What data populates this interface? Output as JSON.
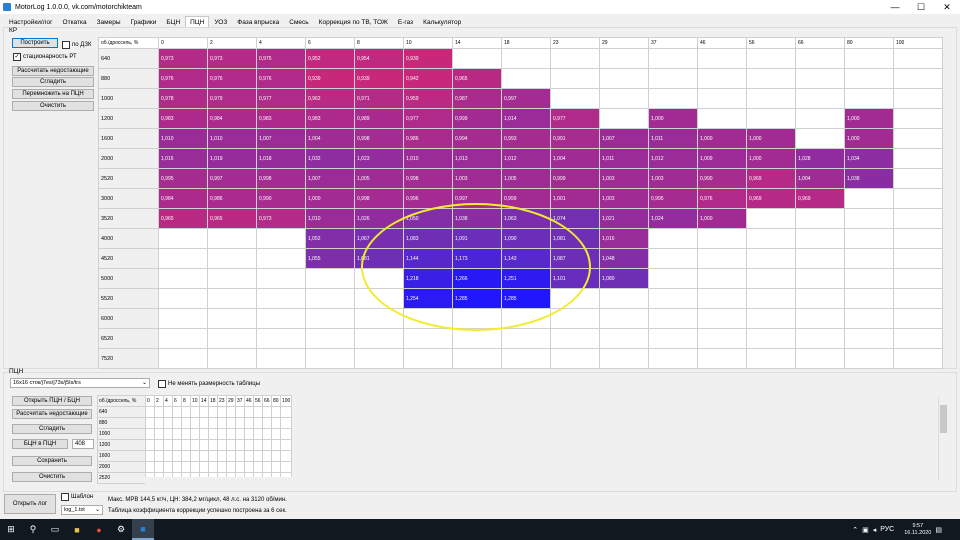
{
  "window": {
    "title": "MotorLog 1.0.0.0, vk.com/motorchikteam",
    "minimize": "—",
    "maximize": "☐",
    "close": "✕"
  },
  "tabs": [
    {
      "label": "Настройки/лог"
    },
    {
      "label": "Откатка"
    },
    {
      "label": "Замеры"
    },
    {
      "label": "Графики"
    },
    {
      "label": "БЦН"
    },
    {
      "label": "ПЦН",
      "active": true
    },
    {
      "label": "УОЗ"
    },
    {
      "label": "Фаза впрыска"
    },
    {
      "label": "Смесь"
    },
    {
      "label": "Коррекция по ТВ, ТОЖ"
    },
    {
      "label": "E-газ"
    },
    {
      "label": "Калькулятор"
    }
  ],
  "kp": {
    "group_label": "КР",
    "build_button": "Построить",
    "by_dzk_checkbox": "по ДЗК",
    "stationary_checkbox": "стационарность РТ",
    "calc_missing_button": "Рассчитать недостающие",
    "smooth_button": "Сгладить",
    "multiply_button": "Перемножить на ПЦН",
    "clear_button": "Очистить"
  },
  "kp_table": {
    "corner": "об./дроссель, %",
    "columns": [
      "0",
      "2",
      "4",
      "6",
      "8",
      "10",
      "14",
      "18",
      "23",
      "29",
      "37",
      "46",
      "56",
      "66",
      "80",
      "100"
    ],
    "rows": [
      {
        "rpm": "640",
        "cells": [
          "0,973",
          "0,973",
          "0,975",
          "0,952",
          "0,954",
          "0,939",
          "",
          "",
          "",
          "",
          "",
          "",
          "",
          "",
          "",
          ""
        ]
      },
      {
        "rpm": "880",
        "cells": [
          "0,976",
          "0,976",
          "0,976",
          "0,939",
          "0,939",
          "0,942",
          "0,965",
          "",
          "",
          "",
          "",
          "",
          "",
          "",
          "",
          ""
        ]
      },
      {
        "rpm": "1000",
        "cells": [
          "0,978",
          "0,979",
          "0,977",
          "0,962",
          "0,971",
          "0,959",
          "0,987",
          "0,997",
          "",
          "",
          "",
          "",
          "",
          "",
          "",
          ""
        ]
      },
      {
        "rpm": "1200",
        "cells": [
          "0,983",
          "0,984",
          "0,983",
          "0,983",
          "0,989",
          "0,977",
          "0,999",
          "1,014",
          "0,977",
          "",
          "1,000",
          "",
          "",
          "",
          "1,000",
          ""
        ]
      },
      {
        "rpm": "1600",
        "cells": [
          "1,010",
          "1,010",
          "1,007",
          "1,004",
          "0,998",
          "0,986",
          "0,994",
          "0,993",
          "0,991",
          "1,007",
          "1,011",
          "1,000",
          "1,000",
          "",
          "1,000",
          ""
        ]
      },
      {
        "rpm": "2000",
        "cells": [
          "1,016",
          "1,019",
          "1,018",
          "1,032",
          "1,023",
          "1,010",
          "1,013",
          "1,012",
          "1,004",
          "1,011",
          "1,012",
          "1,009",
          "1,000",
          "1,028",
          "1,034",
          ""
        ]
      },
      {
        "rpm": "2520",
        "cells": [
          "0,995",
          "0,997",
          "0,998",
          "1,007",
          "1,005",
          "0,998",
          "1,003",
          "1,005",
          "0,999",
          "1,003",
          "1,003",
          "0,990",
          "0,969",
          "1,004",
          "1,038",
          ""
        ]
      },
      {
        "rpm": "3000",
        "cells": [
          "0,984",
          "0,986",
          "0,990",
          "1,000",
          "0,998",
          "0,996",
          "0,997",
          "0,999",
          "1,001",
          "1,003",
          "0,995",
          "0,976",
          "0,969",
          "0,969",
          "",
          ""
        ]
      },
      {
        "rpm": "3520",
        "cells": [
          "0,965",
          "0,965",
          "0,973",
          "1,010",
          "1,026",
          "1,050",
          "1,038",
          "1,063",
          "1,074",
          "1,021",
          "1,024",
          "1,000",
          "",
          "",
          "",
          ""
        ]
      },
      {
        "rpm": "4000",
        "cells": [
          "",
          "",
          "",
          "1,052",
          "1,067",
          "1,083",
          "1,091",
          "1,090",
          "1,081",
          "1,016",
          "",
          "",
          "",
          "",
          "",
          ""
        ]
      },
      {
        "rpm": "4520",
        "cells": [
          "",
          "",
          "",
          "1,055",
          "1,081",
          "1,144",
          "1,173",
          "1,143",
          "1,087",
          "1,048",
          "",
          "",
          "",
          "",
          "",
          ""
        ]
      },
      {
        "rpm": "5000",
        "cells": [
          "",
          "",
          "",
          "",
          "",
          "1,218",
          "1,266",
          "1,251",
          "1,101",
          "1,080",
          "",
          "",
          "",
          "",
          "",
          ""
        ]
      },
      {
        "rpm": "5520",
        "cells": [
          "",
          "",
          "",
          "",
          "",
          "1,254",
          "1,285",
          "1,285",
          "",
          "",
          "",
          "",
          "",
          "",
          "",
          ""
        ]
      },
      {
        "rpm": "6000",
        "cells": [
          "",
          "",
          "",
          "",
          "",
          "",
          "",
          "",
          "",
          "",
          "",
          "",
          "",
          "",
          "",
          ""
        ]
      },
      {
        "rpm": "6520",
        "cells": [
          "",
          "",
          "",
          "",
          "",
          "",
          "",
          "",
          "",
          "",
          "",
          "",
          "",
          "",
          "",
          ""
        ]
      },
      {
        "rpm": "7520",
        "cells": [
          "",
          "",
          "",
          "",
          "",
          "",
          "",
          "",
          "",
          "",
          "",
          "",
          "",
          "",
          "",
          ""
        ]
      }
    ]
  },
  "ptsn": {
    "group_label": "ПЦН",
    "table_select": "16x16 сток/j7es/j73s/j5ls/trs",
    "keep_size_checkbox": "Не менять размерность таблицы",
    "open_button": "Открыть ПЦН / БЦН",
    "calc_missing_button": "Рассчитать недостающие",
    "smooth_button": "Сгладить",
    "bcn_to_ptsn_button": "БЦН в ПЦН",
    "bcn_value": "408",
    "save_button": "Сохранить",
    "clear_button": "Очистить",
    "corner": "об./дроссель, %",
    "columns": [
      "0",
      "2",
      "4",
      "6",
      "8",
      "10",
      "14",
      "18",
      "23",
      "29",
      "37",
      "46",
      "56",
      "66",
      "80",
      "100"
    ],
    "rows": [
      "640",
      "880",
      "1000",
      "1200",
      "1600",
      "2000",
      "2520"
    ]
  },
  "bottom": {
    "open_log_button": "Открыть лог",
    "template_checkbox": "Шаблон",
    "log_select": "log_1.txt",
    "stats_text": "Макс. МРВ 144,5 кг/ч, ЦН: 384,2 мг/цикл, 48 л.с. на 3120 об/мин.",
    "status_text": "Таблица коэффициента коррекции успешно построена за 6 сек."
  },
  "taskbar": {
    "lang": "РУС",
    "time": "9:57",
    "date": "16.11.2020"
  },
  "colors": {
    "low": "#c8287a",
    "mid": "#6f2fb4",
    "high": "#1e16ff",
    "ellipse": "#f2eb2e"
  }
}
